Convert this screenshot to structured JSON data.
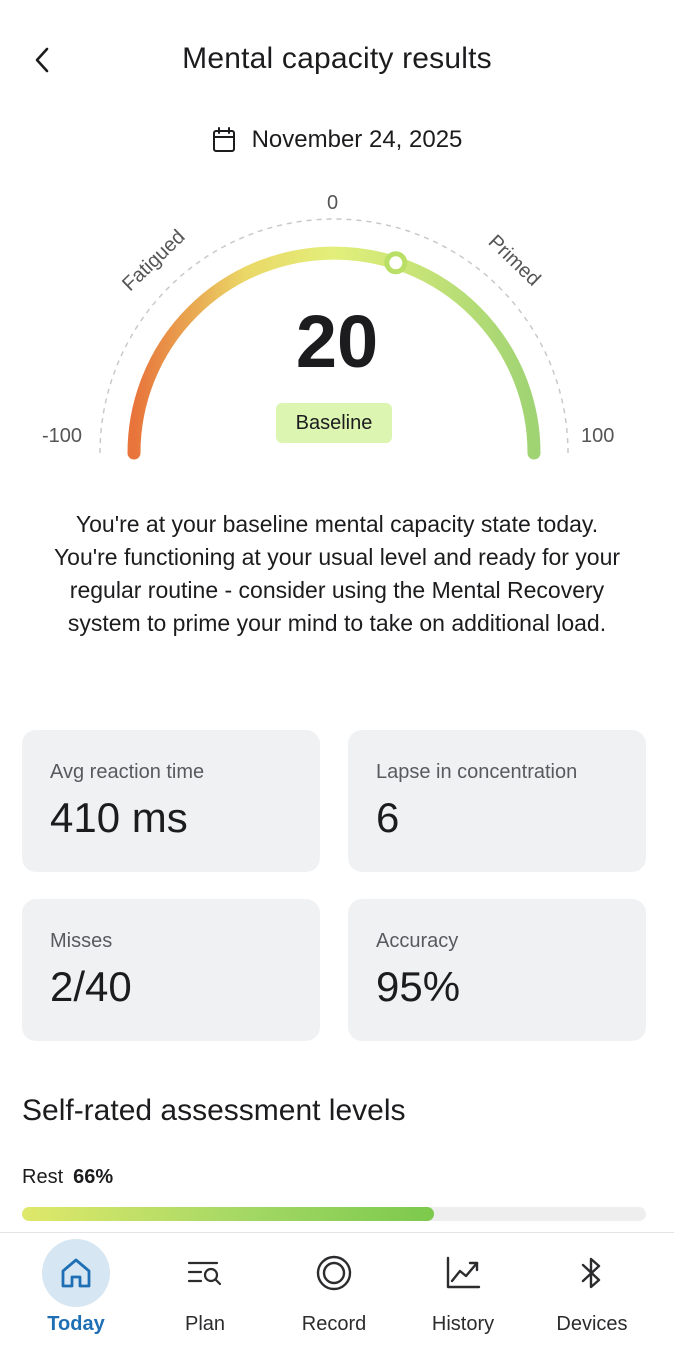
{
  "header": {
    "title": "Mental capacity results"
  },
  "date": {
    "text": "November 24, 2025"
  },
  "gauge": {
    "value": "20",
    "score": 20,
    "min": -100,
    "max": 100,
    "min_label": "-100",
    "max_label": "100",
    "mid_label": "0",
    "left_zone_label": "Fatigued",
    "right_zone_label": "Primed",
    "state_badge": "Baseline",
    "colors": {
      "low": "#e8743b",
      "mid_low": "#ead867",
      "mid": "#e3ef7a",
      "high": "#9fd373",
      "badge_bg": "#dcf5b1"
    }
  },
  "description": {
    "text": "You're at your baseline mental capacity state today. You're functioning at your usual level and ready for your regular routine - consider using the Mental Recovery system to prime your mind to take on additional load."
  },
  "stats": [
    {
      "label": "Avg reaction time",
      "value": "410 ms"
    },
    {
      "label": "Lapse in concentration",
      "value": "6"
    },
    {
      "label": "Misses",
      "value": "2/40"
    },
    {
      "label": "Accuracy",
      "value": "95%"
    }
  ],
  "self_rated": {
    "title": "Self-rated assessment levels",
    "items": [
      {
        "label": "Rest",
        "value_text": "66%",
        "fraction": 0.66
      }
    ]
  },
  "nav": {
    "active_color": "#1f6fb5",
    "items": [
      {
        "label": "Today",
        "icon": "home-icon",
        "active": true
      },
      {
        "label": "Plan",
        "icon": "plan-search-icon",
        "active": false
      },
      {
        "label": "Record",
        "icon": "record-icon",
        "active": false
      },
      {
        "label": "History",
        "icon": "trend-chart-icon",
        "active": false
      },
      {
        "label": "Devices",
        "icon": "bluetooth-icon",
        "active": false
      }
    ]
  }
}
